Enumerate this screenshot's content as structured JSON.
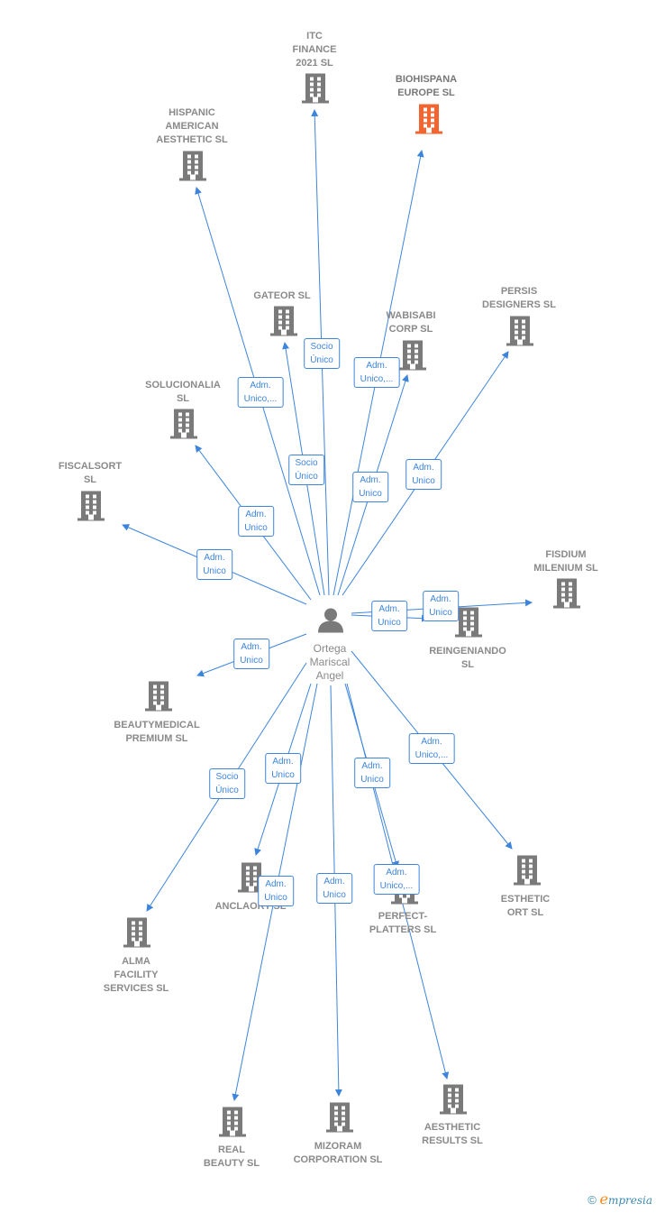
{
  "colors": {
    "edge": "#3d85dc",
    "building": "#7a7a7a",
    "highlight": "#f26430",
    "label": "#8a8a8a"
  },
  "center": {
    "name_lines": [
      "Ortega",
      "Mariscal",
      "Angel"
    ],
    "icon": "person-icon"
  },
  "nodes": [
    {
      "id": "itc",
      "lines": [
        "ITC",
        "FINANCE",
        "2021  SL"
      ]
    },
    {
      "id": "biohispana",
      "lines": [
        "BIOHISPANA",
        "EUROPE  SL"
      ],
      "highlight": true
    },
    {
      "id": "hispanic",
      "lines": [
        "HISPANIC",
        "AMERICAN",
        "AESTHETIC  SL"
      ]
    },
    {
      "id": "gateor",
      "lines": [
        "GATEOR SL"
      ]
    },
    {
      "id": "wabisabi",
      "lines": [
        "WABISABI",
        "CORP  SL"
      ]
    },
    {
      "id": "persis",
      "lines": [
        "PERSIS",
        "DESIGNERS SL"
      ]
    },
    {
      "id": "solucionalia",
      "lines": [
        "SOLUCIONALIA",
        "SL"
      ]
    },
    {
      "id": "fiscalsort",
      "lines": [
        "FISCALSORT",
        "SL"
      ]
    },
    {
      "id": "fisdium",
      "lines": [
        "FISDIUM",
        "MILENIUM  SL"
      ]
    },
    {
      "id": "reingeniando",
      "lines": [
        "REINGENIANDO",
        "SL"
      ]
    },
    {
      "id": "beautymedical",
      "lines": [
        "BEAUTYMEDICAL",
        "PREMIUM  SL"
      ]
    },
    {
      "id": "esthetic",
      "lines": [
        "ESTHETIC",
        "ORT  SL"
      ]
    },
    {
      "id": "anclaort",
      "lines": [
        "ANCLAORT SL"
      ]
    },
    {
      "id": "perfect",
      "lines": [
        "PERFECT-",
        "PLATTERS SL"
      ]
    },
    {
      "id": "alma",
      "lines": [
        "ALMA",
        "FACILITY",
        "SERVICES SL"
      ]
    },
    {
      "id": "realbeauty",
      "lines": [
        "REAL",
        "BEAUTY  SL"
      ]
    },
    {
      "id": "mizoram",
      "lines": [
        "MIZORAM",
        "CORPORATION SL"
      ]
    },
    {
      "id": "aesthetic",
      "lines": [
        "AESTHETIC",
        "RESULTS  SL"
      ]
    }
  ],
  "edges": [
    {
      "to": "itc",
      "label": [
        "Socio",
        "Único"
      ]
    },
    {
      "to": "biohispana",
      "label": [
        "Adm.",
        "Unico,..."
      ]
    },
    {
      "to": "hispanic",
      "label": [
        "Adm.",
        "Unico,..."
      ]
    },
    {
      "to": "gateor",
      "label": [
        "Socio",
        "Único"
      ]
    },
    {
      "to": "wabisabi",
      "label": [
        "Adm.",
        "Unico"
      ]
    },
    {
      "to": "persis",
      "label": [
        "Adm.",
        "Unico"
      ]
    },
    {
      "to": "solucionalia",
      "label": [
        "Adm.",
        "Unico"
      ]
    },
    {
      "to": "fiscalsort",
      "label": [
        "Adm.",
        "Unico"
      ]
    },
    {
      "to": "fisdium",
      "label": [
        "Adm.",
        "Unico"
      ]
    },
    {
      "to": "reingeniando",
      "label": [
        "Adm.",
        "Unico"
      ]
    },
    {
      "to": "beautymedical",
      "label": [
        "Adm.",
        "Unico"
      ]
    },
    {
      "to": "alma",
      "label": [
        "Socio",
        "Único"
      ]
    },
    {
      "to": "anclaort",
      "label": [
        "Adm.",
        "Unico"
      ]
    },
    {
      "to": "realbeauty",
      "label": [
        "Adm.",
        "Unico"
      ]
    },
    {
      "to": "mizoram",
      "label": [
        "Adm.",
        "Unico"
      ]
    },
    {
      "to": "perfect",
      "label": [
        "Adm.",
        "Unico"
      ]
    },
    {
      "to": "aesthetic",
      "label": [
        "Adm.",
        "Unico,..."
      ]
    },
    {
      "to": "esthetic",
      "label": [
        "Adm.",
        "Unico,..."
      ]
    }
  ],
  "footer": {
    "copyright": "©",
    "brand_initial": "e",
    "brand_rest": "mpresia"
  }
}
